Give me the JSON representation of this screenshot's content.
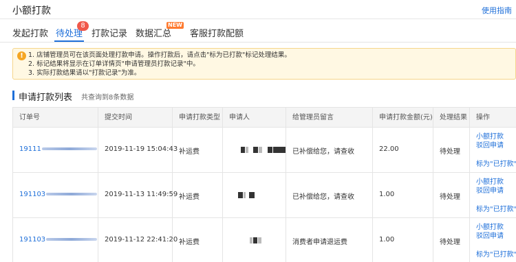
{
  "header": {
    "title": "小额打款",
    "help_link": "使用指南"
  },
  "tabs": [
    {
      "label": "发起打款"
    },
    {
      "label": "待处理",
      "badge": "8"
    },
    {
      "label": "打款记录"
    },
    {
      "label": "数据汇总",
      "badge": "NEW"
    },
    {
      "label": "客服打款配额"
    }
  ],
  "notice": {
    "lines": [
      "1. 店铺管理员可在该页面处理打款申请。操作打款后，请点击\"标为已打款\"标记处理结果。",
      "2. 标记结果将显示在订单详情页\"申请管理员打款记录\"中。",
      "3. 实际打款结果请以\"打款记录\"为准。"
    ]
  },
  "list": {
    "title": "申请打款列表",
    "subtitle": "共查询到8条数据",
    "columns": [
      "订单号",
      "提交时间",
      "申请打款类型",
      "申请人",
      "给管理员留言",
      "申请打款金额(元)",
      "处理结果",
      "操作"
    ],
    "rows": [
      {
        "order_no": "19111",
        "time": "2019-11-19 15:04:43",
        "type": "补运费",
        "message": "已补偿给您，请查收",
        "amount": "22.00",
        "status": "待处理"
      },
      {
        "order_no": "191103",
        "time": "2019-11-13 11:49:59",
        "type": "补运费",
        "message": "已补偿给您，请查收",
        "amount": "1.00",
        "status": "待处理"
      },
      {
        "order_no": "191103",
        "time": "2019-11-12 22:41:20",
        "type": "补运费",
        "message": "消费者申请退运费",
        "amount": "1.00",
        "status": "待处理"
      }
    ],
    "actions": {
      "pay": "小额打款",
      "reject": "驳回申请",
      "mark": "标为\"已打款\""
    }
  }
}
